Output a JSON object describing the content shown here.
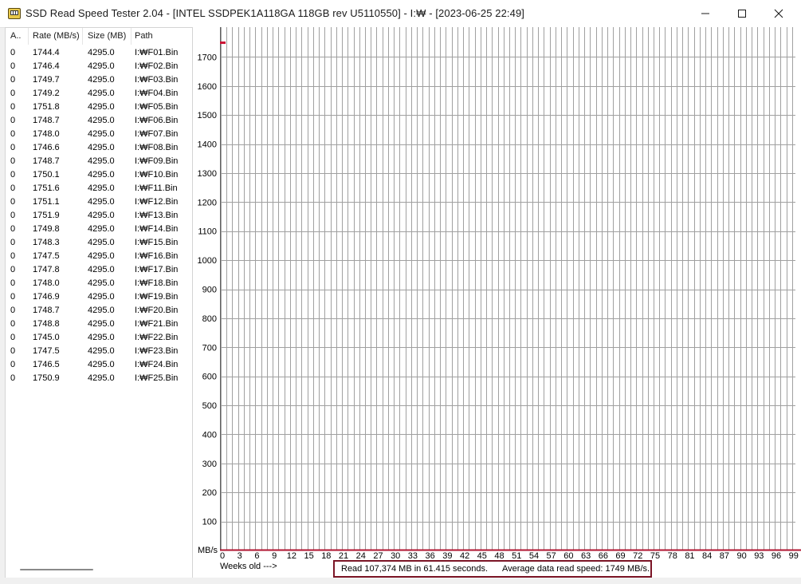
{
  "window": {
    "title": "SSD Read Speed Tester 2.04 - [INTEL SSDPEK1A118GA 118GB rev U5110550] - I:₩ - [2023-06-25 22:49]",
    "icons": {
      "app": "drive-icon",
      "minimize": "minimize-icon",
      "maximize": "maximize-icon",
      "close": "close-icon"
    }
  },
  "list": {
    "columns": [
      "A..",
      "Rate (MB/s)",
      "Size (MB)",
      "Path"
    ],
    "rows": [
      {
        "a": "0",
        "rate": "1744.4",
        "size": "4295.0",
        "path": "I:₩F01.Bin"
      },
      {
        "a": "0",
        "rate": "1746.4",
        "size": "4295.0",
        "path": "I:₩F02.Bin"
      },
      {
        "a": "0",
        "rate": "1749.7",
        "size": "4295.0",
        "path": "I:₩F03.Bin"
      },
      {
        "a": "0",
        "rate": "1749.2",
        "size": "4295.0",
        "path": "I:₩F04.Bin"
      },
      {
        "a": "0",
        "rate": "1751.8",
        "size": "4295.0",
        "path": "I:₩F05.Bin"
      },
      {
        "a": "0",
        "rate": "1748.7",
        "size": "4295.0",
        "path": "I:₩F06.Bin"
      },
      {
        "a": "0",
        "rate": "1748.0",
        "size": "4295.0",
        "path": "I:₩F07.Bin"
      },
      {
        "a": "0",
        "rate": "1746.6",
        "size": "4295.0",
        "path": "I:₩F08.Bin"
      },
      {
        "a": "0",
        "rate": "1748.7",
        "size": "4295.0",
        "path": "I:₩F09.Bin"
      },
      {
        "a": "0",
        "rate": "1750.1",
        "size": "4295.0",
        "path": "I:₩F10.Bin"
      },
      {
        "a": "0",
        "rate": "1751.6",
        "size": "4295.0",
        "path": "I:₩F11.Bin"
      },
      {
        "a": "0",
        "rate": "1751.1",
        "size": "4295.0",
        "path": "I:₩F12.Bin"
      },
      {
        "a": "0",
        "rate": "1751.9",
        "size": "4295.0",
        "path": "I:₩F13.Bin"
      },
      {
        "a": "0",
        "rate": "1749.8",
        "size": "4295.0",
        "path": "I:₩F14.Bin"
      },
      {
        "a": "0",
        "rate": "1748.3",
        "size": "4295.0",
        "path": "I:₩F15.Bin"
      },
      {
        "a": "0",
        "rate": "1747.5",
        "size": "4295.0",
        "path": "I:₩F16.Bin"
      },
      {
        "a": "0",
        "rate": "1747.8",
        "size": "4295.0",
        "path": "I:₩F17.Bin"
      },
      {
        "a": "0",
        "rate": "1748.0",
        "size": "4295.0",
        "path": "I:₩F18.Bin"
      },
      {
        "a": "0",
        "rate": "1746.9",
        "size": "4295.0",
        "path": "I:₩F19.Bin"
      },
      {
        "a": "0",
        "rate": "1748.7",
        "size": "4295.0",
        "path": "I:₩F20.Bin"
      },
      {
        "a": "0",
        "rate": "1748.8",
        "size": "4295.0",
        "path": "I:₩F21.Bin"
      },
      {
        "a": "0",
        "rate": "1745.0",
        "size": "4295.0",
        "path": "I:₩F22.Bin"
      },
      {
        "a": "0",
        "rate": "1747.5",
        "size": "4295.0",
        "path": "I:₩F23.Bin"
      },
      {
        "a": "0",
        "rate": "1746.5",
        "size": "4295.0",
        "path": "I:₩F24.Bin"
      },
      {
        "a": "0",
        "rate": "1750.9",
        "size": "4295.0",
        "path": "I:₩F25.Bin"
      }
    ]
  },
  "chart_data": {
    "type": "scatter",
    "ylabel": "MB/s",
    "xlabel": "Weeks old --->",
    "y_ticks": [
      100,
      200,
      300,
      400,
      500,
      600,
      700,
      800,
      900,
      1000,
      1100,
      1200,
      1300,
      1400,
      1500,
      1600,
      1700
    ],
    "x_ticks": [
      0,
      3,
      6,
      9,
      12,
      15,
      18,
      21,
      24,
      27,
      30,
      33,
      36,
      39,
      42,
      45,
      48,
      51,
      54,
      57,
      60,
      63,
      66,
      69,
      72,
      75,
      78,
      81,
      84,
      87,
      90,
      93,
      96,
      99
    ],
    "ylim": [
      0,
      1750
    ],
    "xlim": [
      0,
      99
    ],
    "grid": true,
    "points": [
      {
        "x": 0,
        "y": 1749
      }
    ],
    "colors": {
      "marker": "#cc1133",
      "baseline": "#b01530",
      "grid": "#a0a0a0"
    }
  },
  "status": {
    "read": "Read 107,374 MB in 61.415 seconds.",
    "average": "Average data read speed: 1749 MB/s."
  }
}
